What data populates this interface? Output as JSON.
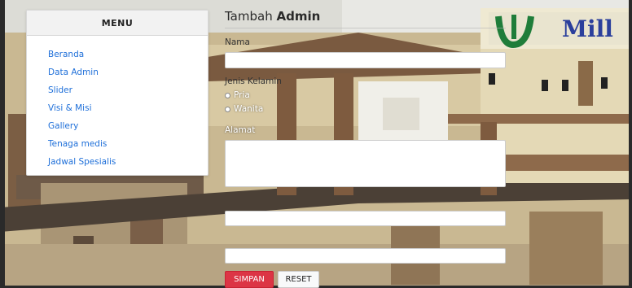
{
  "menu": {
    "header": "MENU",
    "items": [
      {
        "label": "Beranda"
      },
      {
        "label": "Data Admin"
      },
      {
        "label": "Slider"
      },
      {
        "label": "Visi & Misi"
      },
      {
        "label": "Gallery"
      },
      {
        "label": "Tenaga medis"
      },
      {
        "label": "Jadwal Spesialis"
      }
    ]
  },
  "form": {
    "title_prefix": "Tambah ",
    "title_bold": "Admin",
    "nama_label": "Nama",
    "gender_label": "Jenis Kelamin",
    "gender_options": [
      "Pria",
      "Wanita"
    ],
    "alamat_label": "Alamat",
    "save_label": "SIMPAN",
    "reset_label": "RESET"
  },
  "background": {
    "sign_text": "Mill"
  }
}
